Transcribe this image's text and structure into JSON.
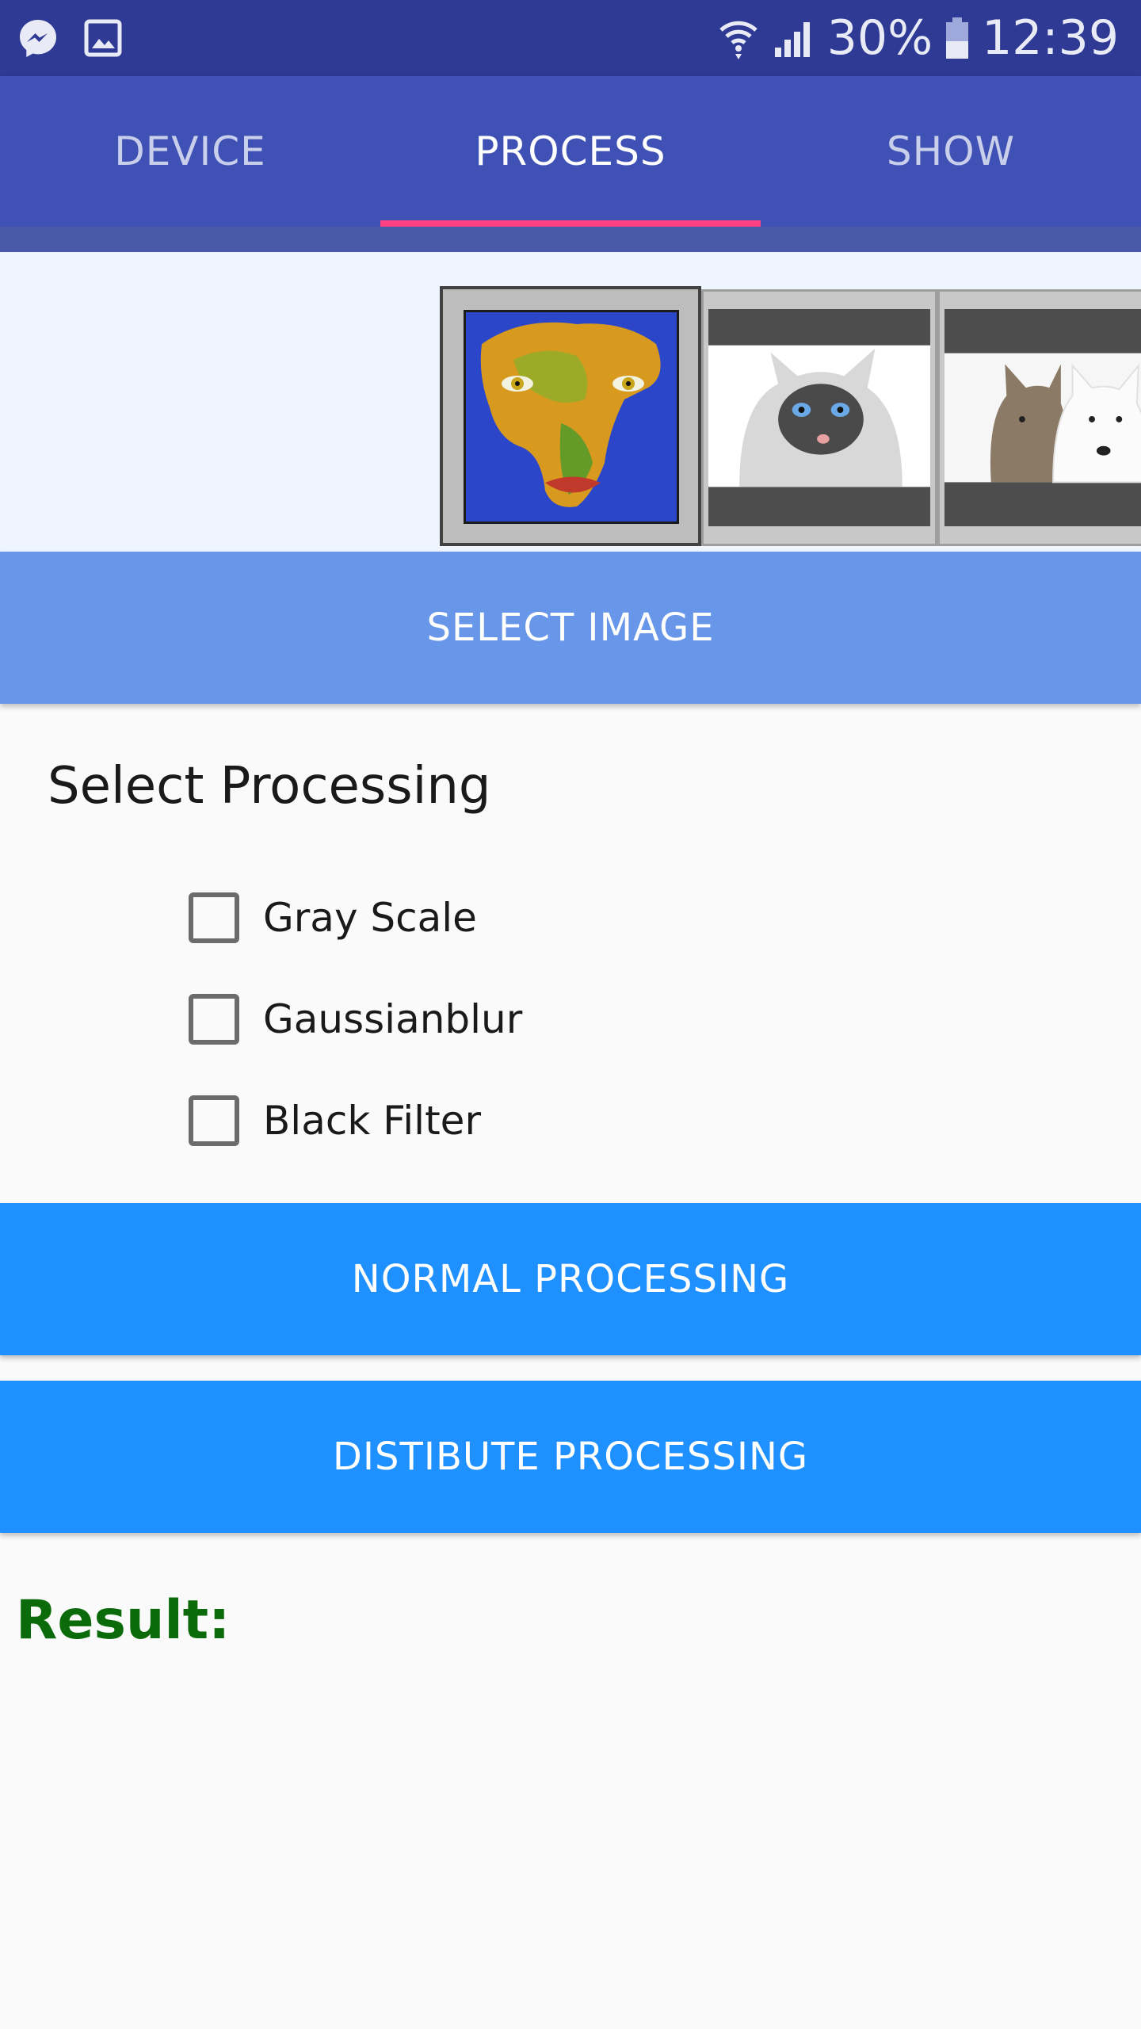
{
  "status_bar": {
    "battery": "30%",
    "time": "12:39",
    "icons": [
      "messenger-icon",
      "gallery-icon",
      "wifi-icon",
      "signal-icon",
      "battery-icon"
    ]
  },
  "tabs": [
    {
      "label": "DEVICE",
      "active": false
    },
    {
      "label": "PROCESS",
      "active": true
    },
    {
      "label": "SHOW",
      "active": false
    }
  ],
  "gallery": {
    "thumbnails": [
      "face-africa-map-image",
      "cat-image",
      "wolf-dog-image"
    ],
    "selected_index": 0
  },
  "buttons": {
    "select_image": "SELECT IMAGE",
    "normal_processing": "NORMAL PROCESSING",
    "distribute_processing": "DISTIBUTE PROCESSING"
  },
  "processing": {
    "title": "Select Processing",
    "options": [
      {
        "label": "Gray Scale",
        "checked": false
      },
      {
        "label": "Gaussianblur",
        "checked": false
      },
      {
        "label": "Black Filter",
        "checked": false
      }
    ]
  },
  "result": {
    "label": "Result:"
  },
  "colors": {
    "status_bar": "#2f3a95",
    "tab_bar": "#3f51b5",
    "tab_indicator": "#ff4081",
    "select_button": "#6896e9",
    "action_button": "#1e90ff",
    "result_text": "#0b6b0b"
  }
}
